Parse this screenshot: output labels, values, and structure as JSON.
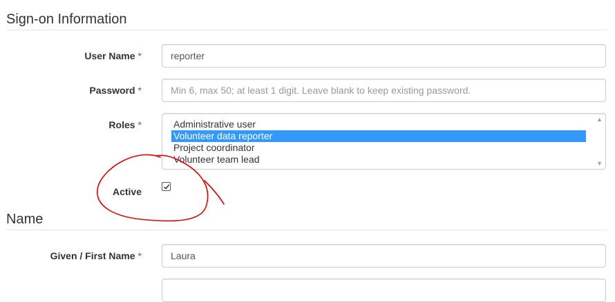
{
  "signon": {
    "title": "Sign-on Information",
    "username": {
      "label": "User Name",
      "required": "*",
      "value": "reporter"
    },
    "password": {
      "label": "Password",
      "required": "*",
      "value": "",
      "placeholder": "Min 6, max 50; at least 1 digit. Leave blank to keep existing password."
    },
    "roles": {
      "label": "Roles",
      "required": "*",
      "options": [
        "Administrative user",
        "Volunteer data reporter",
        "Project coordinator",
        "Volunteer team lead"
      ],
      "selected": "Volunteer data reporter"
    },
    "active": {
      "label": "Active",
      "checked": true
    }
  },
  "name": {
    "title": "Name",
    "given": {
      "label": "Given / First Name",
      "required": "*",
      "value": "Laura"
    }
  },
  "annotation": {
    "color": "#e00000",
    "shape": "hand-drawn circle around Active checkbox"
  }
}
